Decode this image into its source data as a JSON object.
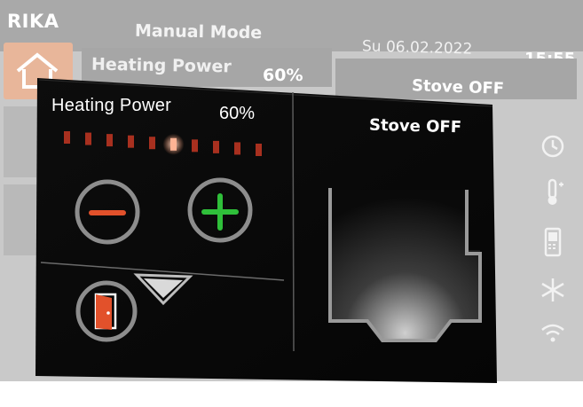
{
  "background_screen": {
    "logo": "RIKA",
    "mode_title": "Manual Mode",
    "date": "Su 06.02.2022",
    "time": "15:55",
    "heating_label": "Heating Power",
    "heating_value": "60%",
    "stove_status": "Stove OFF",
    "sidebar_icons": [
      "home-icon",
      "flame-icon",
      "gear-icon"
    ],
    "right_icons": [
      "clock-icon",
      "thermometer-icon",
      "phone-icon",
      "snowflake-icon",
      "wifi-icon"
    ]
  },
  "panel": {
    "heating_label": "Heating Power",
    "heating_value": "60%",
    "heating_level": 0.6,
    "level_steps": 10,
    "stove_status": "Stove OFF",
    "buttons": [
      "minus",
      "plus",
      "door",
      "expand"
    ]
  },
  "colors": {
    "accent_orange": "#e2512b",
    "accent_green": "#2fbf3a",
    "led_off": "#a8301f",
    "led_on": "#ffb394",
    "panel_bg": "#000000"
  }
}
